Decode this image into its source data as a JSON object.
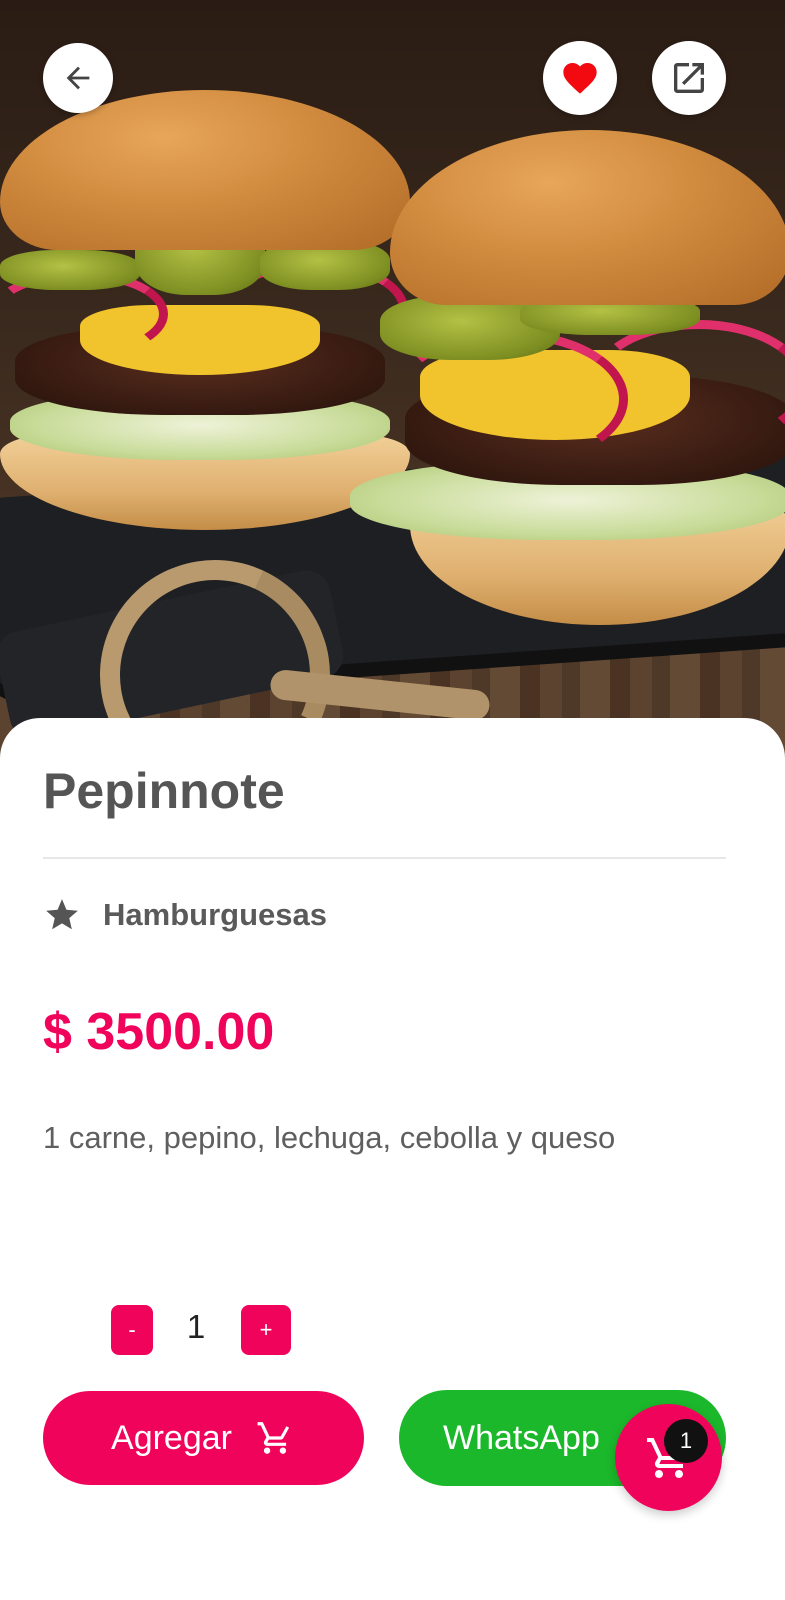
{
  "product": {
    "name": "Pepinnote",
    "category": "Hamburguesas",
    "price": "$ 3500.00",
    "description": "1 carne, pepino, lechuga, cebolla y queso"
  },
  "quantity": {
    "minus_label": "-",
    "value": "1",
    "plus_label": "+"
  },
  "actions": {
    "add_label": "Agregar",
    "whatsapp_label": "WhatsApp"
  },
  "cart": {
    "count": "1"
  },
  "icons": {
    "back": "arrow-left-icon",
    "favorite": "heart-icon",
    "share": "external-link-icon",
    "category": "star-icon",
    "add_cart": "cart-icon",
    "fab_cart": "cart-icon"
  },
  "colors": {
    "accent": "#f0045b",
    "whatsapp": "#1bb82b",
    "title_text": "#555555",
    "favorite": "#f20a10"
  }
}
